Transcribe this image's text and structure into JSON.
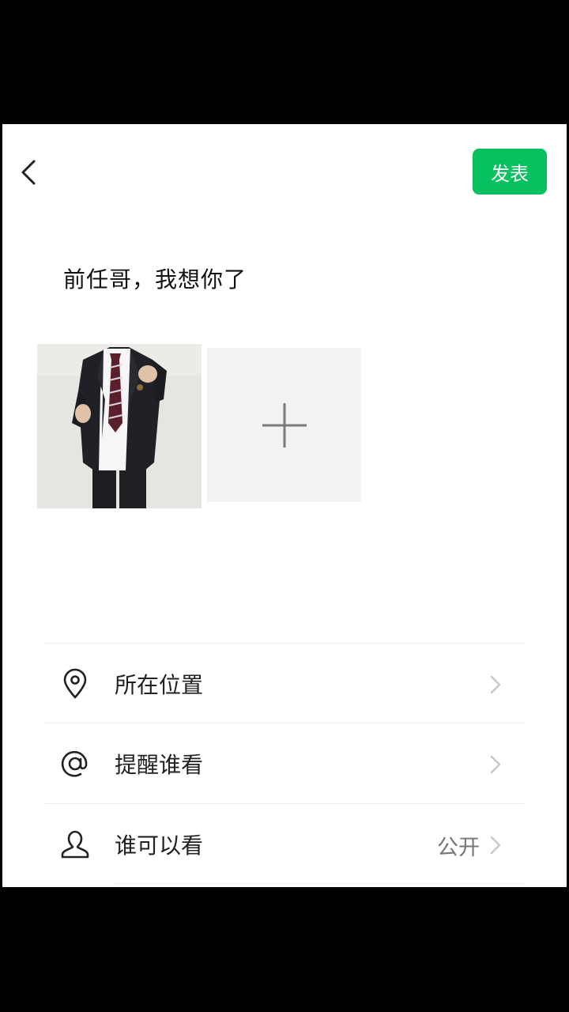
{
  "header": {
    "back_icon": "chevron-left-icon",
    "publish_label": "发表",
    "publish_color": "#07c160"
  },
  "post": {
    "text": "前任哥，我想你了"
  },
  "media": {
    "photo": "uniform-photo",
    "add_icon": "plus-icon"
  },
  "options": [
    {
      "icon": "location-pin-icon",
      "label": "所在位置",
      "value": ""
    },
    {
      "icon": "at-sign-icon",
      "label": "提醒谁看",
      "value": ""
    },
    {
      "icon": "person-icon",
      "label": "谁可以看",
      "value": "公开"
    }
  ]
}
